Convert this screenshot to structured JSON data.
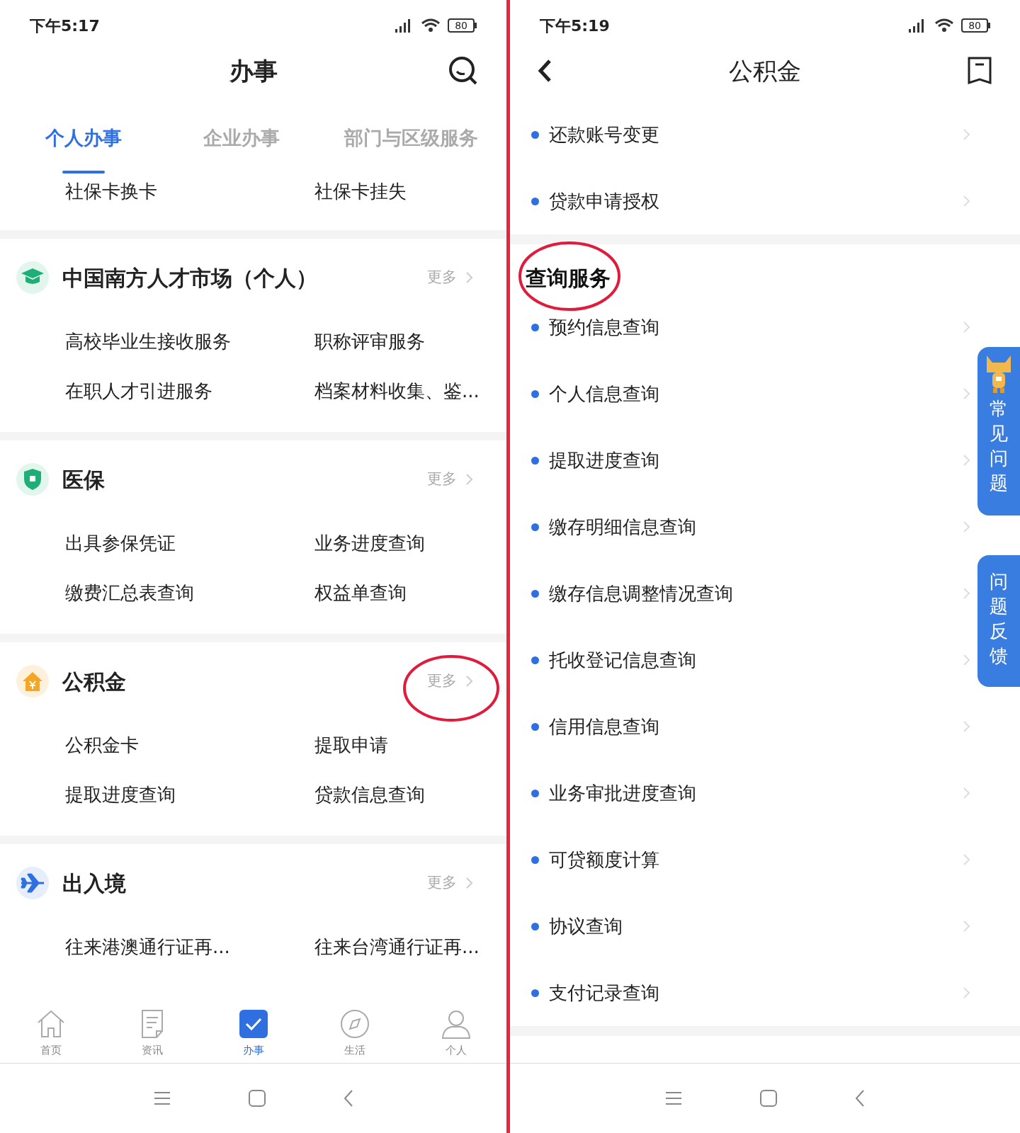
{
  "left": {
    "status_time": "下午5:17",
    "battery": "80",
    "title": "办事",
    "tabs": [
      {
        "label": "个人办事",
        "selected": true
      },
      {
        "label": "企业办事",
        "selected": false
      },
      {
        "label": "部门与区级服务",
        "selected": false
      }
    ],
    "top_items": [
      "社保卡换卡",
      "社保卡挂失"
    ],
    "sections": [
      {
        "kind": "talent",
        "title": "中国南方人才市场（个人）",
        "more": "更多",
        "circled": false,
        "items": [
          "高校毕业生接收服务",
          "职称评审服务",
          "在职人才引进服务",
          "档案材料收集、鉴..."
        ]
      },
      {
        "kind": "medical",
        "title": "医保",
        "more": "更多",
        "circled": false,
        "items": [
          "出具参保凭证",
          "业务进度查询",
          "缴费汇总表查询",
          "权益单查询"
        ]
      },
      {
        "kind": "fund",
        "title": "公积金",
        "more": "更多",
        "circled": true,
        "items": [
          "公积金卡",
          "提取申请",
          "提取进度查询",
          "贷款信息查询"
        ]
      },
      {
        "kind": "travel",
        "title": "出入境",
        "more": "更多",
        "circled": false,
        "items": [
          "往来港澳通行证再...",
          "往来台湾通行证再..."
        ]
      }
    ],
    "bottom_nav": [
      {
        "kind": "home",
        "label": "首页",
        "selected": false
      },
      {
        "kind": "news",
        "label": "资讯",
        "selected": false
      },
      {
        "kind": "tasks",
        "label": "办事",
        "selected": true
      },
      {
        "kind": "life",
        "label": "生活",
        "selected": false
      },
      {
        "kind": "me",
        "label": "个人",
        "selected": false
      }
    ]
  },
  "right": {
    "status_time": "下午5:19",
    "battery": "80",
    "title": "公积金",
    "top_items": [
      "还款账号变更",
      "贷款申请授权"
    ],
    "query_section": {
      "title": "查询服务",
      "circled": true,
      "items": [
        "预约信息查询",
        "个人信息查询",
        "提取进度查询",
        "缴存明细信息查询",
        "缴存信息调整情况查询",
        "托收登记信息查询",
        "信用信息查询",
        "业务审批进度查询",
        "可贷额度计算",
        "协议查询",
        "支付记录查询"
      ]
    },
    "float_tabs": [
      {
        "kind": "mascot",
        "label": "常见问题"
      },
      {
        "kind": "plain",
        "label": "问题反馈"
      }
    ]
  }
}
